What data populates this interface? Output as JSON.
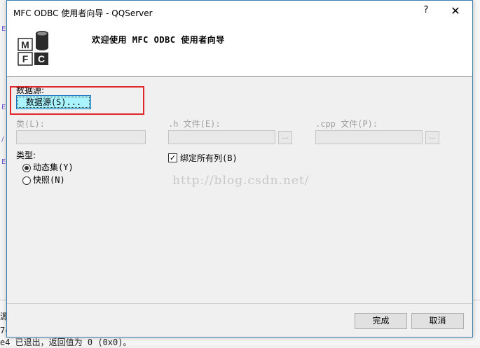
{
  "window": {
    "title": "MFC ODBC 使用者向导 - QQServer",
    "help_label": "?",
    "close_label": "✕"
  },
  "header": {
    "title": "欢迎使用 MFC ODBC 使用者向导",
    "logo_text_top": "M",
    "logo_text_bottom_left": "F",
    "logo_text_bottom_right": "C"
  },
  "datasource": {
    "group_label": "数据源:",
    "button_label": "数据源(S)..."
  },
  "class_field": {
    "label": "类(L):",
    "value": ""
  },
  "h_file_field": {
    "label": ".h 文件(E):",
    "value": "",
    "browse_label": "..."
  },
  "cpp_file_field": {
    "label": ".cpp 文件(P):",
    "value": "",
    "browse_label": "..."
  },
  "type_group": {
    "label": "类型:",
    "options": [
      {
        "label": "动态集(Y)",
        "selected": true
      },
      {
        "label": "快照(N)",
        "selected": false
      }
    ]
  },
  "bind_all": {
    "label": "绑定所有列(B)",
    "checked": true,
    "check_glyph": "✓"
  },
  "watermark": "http://blog.csdn.net/",
  "buttons": {
    "finish": "完成",
    "cancel": "取消"
  },
  "background": {
    "left_marks": [
      "E",
      "E",
      "/",
      "E"
    ],
    "output_lines": [
      "源",
      "7c",
      "e4 已退出，返回值为 0 (0x0)。"
    ]
  },
  "colors": {
    "highlight": "#e0282a",
    "datasource_button": "#aaf4ff",
    "dialog_border": "#3c7fb1"
  }
}
